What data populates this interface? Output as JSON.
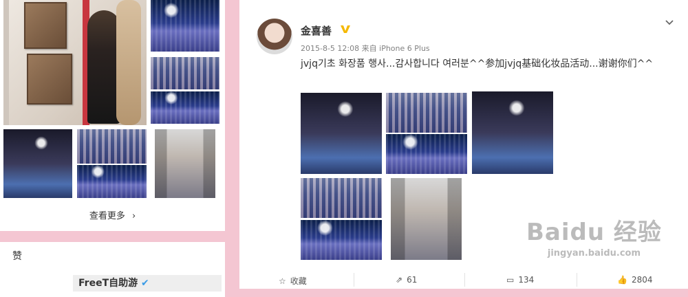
{
  "left": {
    "view_more_label": "查看更多",
    "like_title": "赞",
    "freet_label": "FreeT自助游"
  },
  "post": {
    "username": "金喜善",
    "timestamp": "2015-8-5 12:08",
    "source_prefix": "来自",
    "source": "iPhone 6 Plus",
    "text": "jvjq기초 화장품 행사...감사합니다 여러분^^参加jvjq基础化妆品活动...谢谢你们^^"
  },
  "actions": {
    "favorite_label": "收藏",
    "share_count": "61",
    "comment_count": "134",
    "like_count": "2804"
  },
  "watermark": {
    "logo_text": "Baidu 经验",
    "url": "jingyan.baidu.com"
  },
  "colors": {
    "page_background": "#f4c6d2",
    "vip_badge": "#f5b800"
  }
}
